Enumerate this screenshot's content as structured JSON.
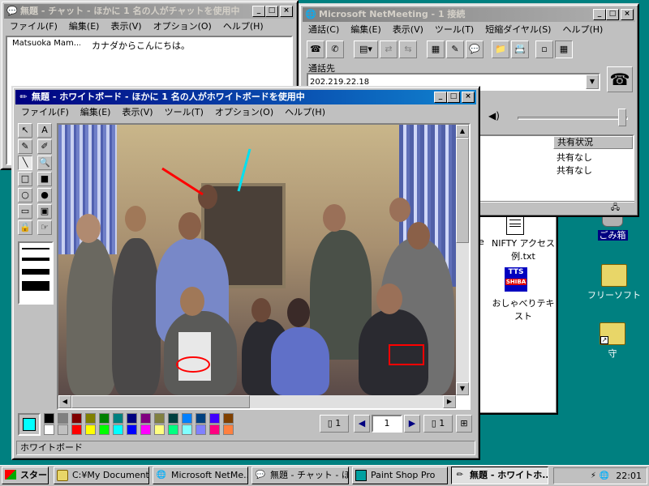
{
  "desktop": {
    "icons": [
      {
        "label": "ごみ箱",
        "name": "recycle-bin"
      },
      {
        "label": "フリーソフト",
        "name": "free-software-folder"
      },
      {
        "label": "守",
        "name": "mamoru-folder"
      }
    ],
    "behind_icons": [
      {
        "label": "NIFTY アクセス例.txt",
        "name": "nifty-text-file"
      },
      {
        "label": "おしゃべりテキスト",
        "name": "oshaberi-text",
        "badge_top": "TTS",
        "badge_bottom": "SHIBA"
      }
    ],
    "behind_label": "e"
  },
  "chat": {
    "title": "無題 - チャット - ほかに 1 名の人がチャットを使用中",
    "menu": [
      "ファイル(F)",
      "編集(E)",
      "表示(V)",
      "オプション(O)",
      "ヘルプ(H)"
    ],
    "messages": [
      {
        "sender": "Matsuoka Mam...",
        "text": "カナダからこんにちは。"
      }
    ]
  },
  "netmeeting": {
    "title": "Microsoft NetMeeting - 1 接続",
    "menu": [
      "通話(C)",
      "編集(E)",
      "表示(V)",
      "ツール(T)",
      "短縮ダイヤル(S)",
      "ヘルプ(H)"
    ],
    "call_label": "通話先",
    "call_value": "202.219.22.18",
    "table_header": "共有状況",
    "table_rows": [
      "共有なし",
      "共有なし"
    ]
  },
  "whiteboard": {
    "title": "無題 - ホワイトボード - ほかに 1 名の人がホワイトボードを使用中",
    "menu": [
      "ファイル(F)",
      "編集(E)",
      "表示(V)",
      "ツール(T)",
      "オプション(O)",
      "ヘルプ(H)"
    ],
    "status": "ホワイトボード",
    "page_current": "1",
    "page_total_left": "1",
    "page_total_right": "1",
    "tools": [
      "arrow-tool",
      "text-tool",
      "pen-tool",
      "highlighter-tool",
      "line-tool",
      "zoom-tool",
      "rect-tool",
      "filled-rect-tool",
      "ellipse-tool",
      "filled-ellipse-tool",
      "select-window-tool",
      "select-area-tool",
      "lock-tool",
      "remote-pointer-tool"
    ],
    "tool_glyphs": [
      "↖",
      "A",
      "✎",
      "✐",
      "╲",
      "🔍",
      "□",
      "■",
      "○",
      "●",
      "▭",
      "▣",
      "🔒",
      "☞"
    ],
    "current_color": "#00ffff",
    "palette": [
      "#000000",
      "#808080",
      "#800000",
      "#808000",
      "#008000",
      "#008080",
      "#000080",
      "#800080",
      "#808040",
      "#004040",
      "#0080ff",
      "#004080",
      "#4000ff",
      "#804000",
      "#ffffff",
      "#c0c0c0",
      "#ff0000",
      "#ffff00",
      "#00ff00",
      "#00ffff",
      "#0000ff",
      "#ff00ff",
      "#ffff80",
      "#00ff80",
      "#80ffff",
      "#8080ff",
      "#ff0080",
      "#ff8040"
    ]
  },
  "taskbar": {
    "start": "スタート",
    "tasks": [
      {
        "label": "C:¥My Document...",
        "name": "task-my-documents",
        "icon": "folder"
      },
      {
        "label": "Microsoft NetMe...",
        "name": "task-netmeeting",
        "icon": "netmeeting"
      },
      {
        "label": "無題 - チャット - ほ...",
        "name": "task-chat",
        "icon": "chat"
      },
      {
        "label": "Paint Shop Pro",
        "name": "task-paintshop",
        "icon": "paint"
      },
      {
        "label": "無題 - ホワイトホ...",
        "name": "task-whiteboard",
        "icon": "whiteboard",
        "pressed": true
      }
    ],
    "clock": "22:01"
  }
}
